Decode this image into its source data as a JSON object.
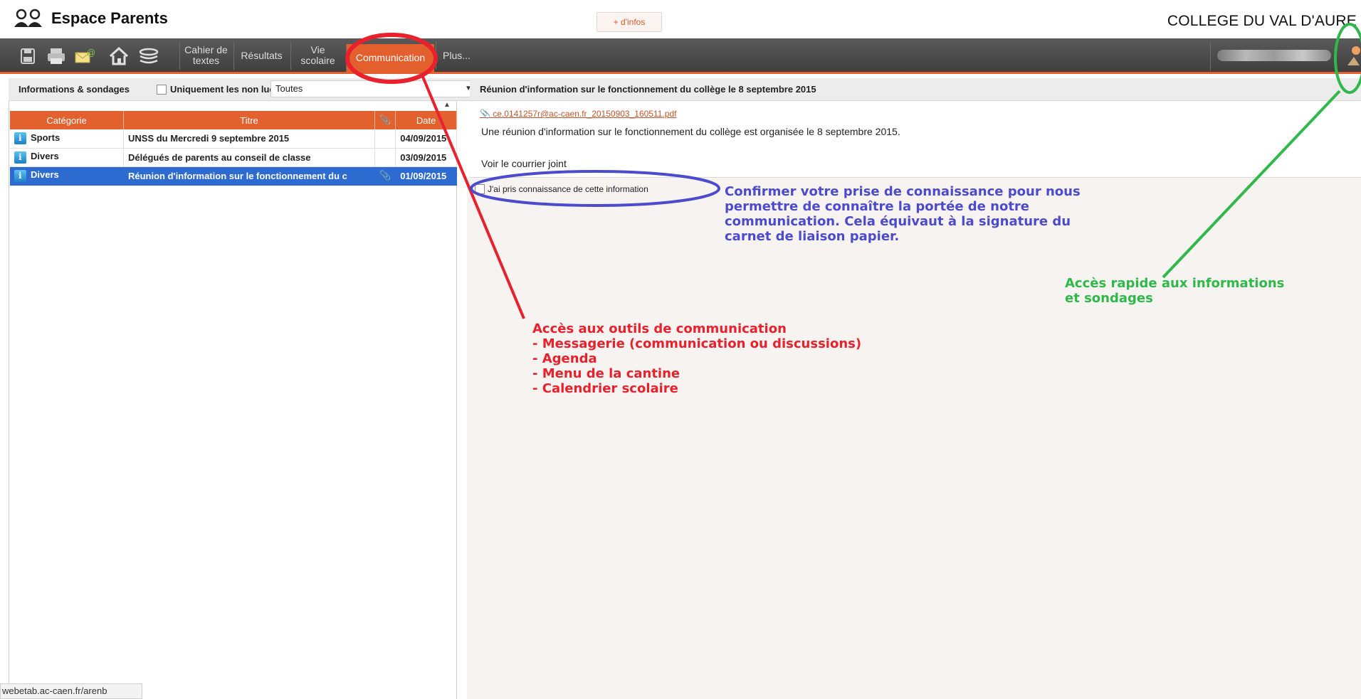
{
  "header": {
    "app_title": "Espace Parents",
    "more_info": "+ d'infos",
    "school_name": "COLLEGE DU VAL D'AURE"
  },
  "toolbar": {
    "icons": [
      "save-icon",
      "print-icon",
      "mail-icon",
      "home-icon",
      "layers-icon"
    ],
    "buttons": [
      {
        "label": "Cahier de textes"
      },
      {
        "label": "Résultats"
      },
      {
        "label": "Vie scolaire"
      },
      {
        "label": "Communication",
        "active": true
      },
      {
        "label": "Plus..."
      }
    ]
  },
  "left": {
    "header_title": "Informations & sondages",
    "unread_label": "Uniquement les non lues",
    "filter_value": "Toutes",
    "columns": [
      "Catégorie",
      "Titre",
      "",
      "Date"
    ],
    "rows": [
      {
        "category": "Sports",
        "title": "UNSS du Mercredi 9 septembre 2015",
        "attachment": false,
        "date": "04/09/2015"
      },
      {
        "category": "Divers",
        "title": "Délégués de parents au conseil de classe",
        "attachment": false,
        "date": "03/09/2015"
      },
      {
        "category": "Divers",
        "title": "Réunion d'information sur le fonctionnement du c",
        "attachment": true,
        "date": "01/09/2015",
        "selected": true
      }
    ]
  },
  "right": {
    "header_title": "Réunion d'information sur le fonctionnement du collège le 8 septembre 2015",
    "attachment": "ce.0141257r@ac-caen.fr_20150903_160511.pdf",
    "body_line1": "Une réunion d'information sur le fonctionnement du collège est organisée le 8 septembre 2015.",
    "body_line2": "Voir le courrier joint",
    "ack_label": "J'ai pris connaissance de cette information"
  },
  "annotations": {
    "blue": [
      "Confirmer votre prise de connaissance pour nous",
      "permettre de connaître la portée de notre",
      "communication. Cela équivaut à la signature du",
      "carnet de liaison papier."
    ],
    "red": [
      "Accès aux outils de communication",
      "- Messagerie (communication ou discussions)",
      "- Agenda",
      "- Menu de la cantine",
      "- Calendrier scolaire"
    ],
    "green": [
      "Accès rapide aux informations",
      "et sondages"
    ]
  },
  "status_bar": {
    "url": "webetab.ac-caen.fr/arenb"
  },
  "colors": {
    "accent": "#e35f2d",
    "selection": "#2d6bd1",
    "toolbar": "#4a4a4a",
    "annotation_red": "#e8212c",
    "annotation_blue": "#4b4bcc",
    "annotation_green": "#30b84a"
  }
}
